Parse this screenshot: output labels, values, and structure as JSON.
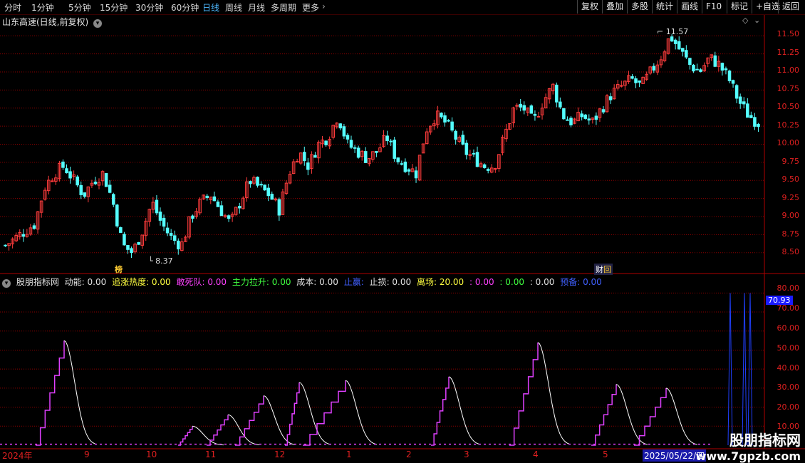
{
  "toolbar": {
    "periods": [
      "分时",
      "1分钟",
      "5分钟",
      "15分钟",
      "30分钟",
      "60分钟",
      "日线",
      "周线",
      "月线",
      "多周期",
      "更多"
    ],
    "active_period": "日线",
    "right_buttons": [
      "复权",
      "叠加",
      "多股",
      "统计",
      "画线",
      "F10",
      "标记",
      "+自选",
      "返回"
    ]
  },
  "main_chart": {
    "title": "山东高速(日线,前复权)",
    "high_label": "11.57",
    "low_label": "8.37",
    "event_tag_1": "榜",
    "event_tag_2": "财",
    "price_axis": [
      "11.50",
      "11.25",
      "11.00",
      "10.75",
      "10.50",
      "10.25",
      "10.00",
      "9.75",
      "9.50",
      "9.25",
      "9.00",
      "8.75",
      "8.50"
    ]
  },
  "indicator": {
    "name": "股朋指标网",
    "items": [
      {
        "label": "动能: 0.00",
        "color": "#e0e0e0"
      },
      {
        "label": "追涨热度: 0.00",
        "color": "#ffff40"
      },
      {
        "label": "敢死队: 0.00",
        "color": "#ff40ff"
      },
      {
        "label": "主力拉升: 0.00",
        "color": "#40ff40"
      },
      {
        "label": "成本: 0.00",
        "color": "#e0e0e0"
      },
      {
        "label": "止赢: ",
        "color": "#4060ff"
      },
      {
        "label": "止损: 0.00",
        "color": "#e0e0e0"
      },
      {
        "label": "离场: 20.00",
        "color": "#ffff40"
      },
      {
        "label": ": 0.00",
        "color": "#ff40ff"
      },
      {
        "label": ": 0.00",
        "color": "#40ff40"
      },
      {
        "label": ": 0.00",
        "color": "#e0e0e0"
      },
      {
        "label": "预备: 0.00",
        "color": "#4060ff"
      }
    ],
    "axis": [
      "80.00",
      "70.00",
      "60.00",
      "50.00",
      "40.00",
      "30.00",
      "20.00",
      "10.00"
    ],
    "current_value": "70.93"
  },
  "x_axis": {
    "labels": [
      "2024年",
      "9",
      "10",
      "11",
      "12",
      "1",
      "2",
      "3",
      "4",
      "5"
    ],
    "cursor_date": "2025/05/22/四"
  },
  "watermark": {
    "line1": "股朋指标网",
    "line2": "www.7gpzb.com"
  },
  "colors": {
    "up": "#ff3c3c",
    "down": "#54ffff",
    "grid": "#8b0000",
    "axis_text": "#e02020",
    "magenta": "#e040ff",
    "white_line": "#ffffff"
  },
  "chart_data": {
    "type": "line",
    "title": "",
    "xlabel": "",
    "ylabel": "",
    "ylim": [
      8.3,
      11.7
    ],
    "x": [
      "2024-08",
      "2024-09",
      "2024-10",
      "2024-11",
      "2024-12",
      "2025-01",
      "2025-02",
      "2025-03",
      "2025-04",
      "2025-05"
    ],
    "series": [
      {
        "name": "",
        "values": [
          8.7,
          9.6,
          8.6,
          9.2,
          10.0,
          9.8,
          10.3,
          9.9,
          10.8,
          11.1,
          10.3
        ]
      }
    ],
    "price_path": [
      8.6,
      8.7,
      8.8,
      8.9,
      9.4,
      9.6,
      9.7,
      9.5,
      9.3,
      9.5,
      9.6,
      9.2,
      8.6,
      8.5,
      8.8,
      9.2,
      8.9,
      8.7,
      8.6,
      9.0,
      9.2,
      9.3,
      9.1,
      8.9,
      9.2,
      9.5,
      9.4,
      9.3,
      9.1,
      9.6,
      9.9,
      9.7,
      10.0,
      10.1,
      10.4,
      10.0,
      9.9,
      9.8,
      9.9,
      10.1,
      9.8,
      9.7,
      9.6,
      10.2,
      10.4,
      10.3,
      10.1,
      9.9,
      9.8,
      9.7,
      9.7,
      10.1,
      10.5,
      10.5,
      10.3,
      10.6,
      10.8,
      10.4,
      10.3,
      10.4,
      10.3,
      10.5,
      10.7,
      10.8,
      10.9,
      10.8,
      11.0,
      11.2,
      11.5,
      11.3,
      11.1,
      11.0,
      11.2,
      11.1,
      10.9,
      10.6,
      10.4,
      10.3
    ],
    "closing_value": 10.3,
    "high": 11.57,
    "low": 8.37
  }
}
